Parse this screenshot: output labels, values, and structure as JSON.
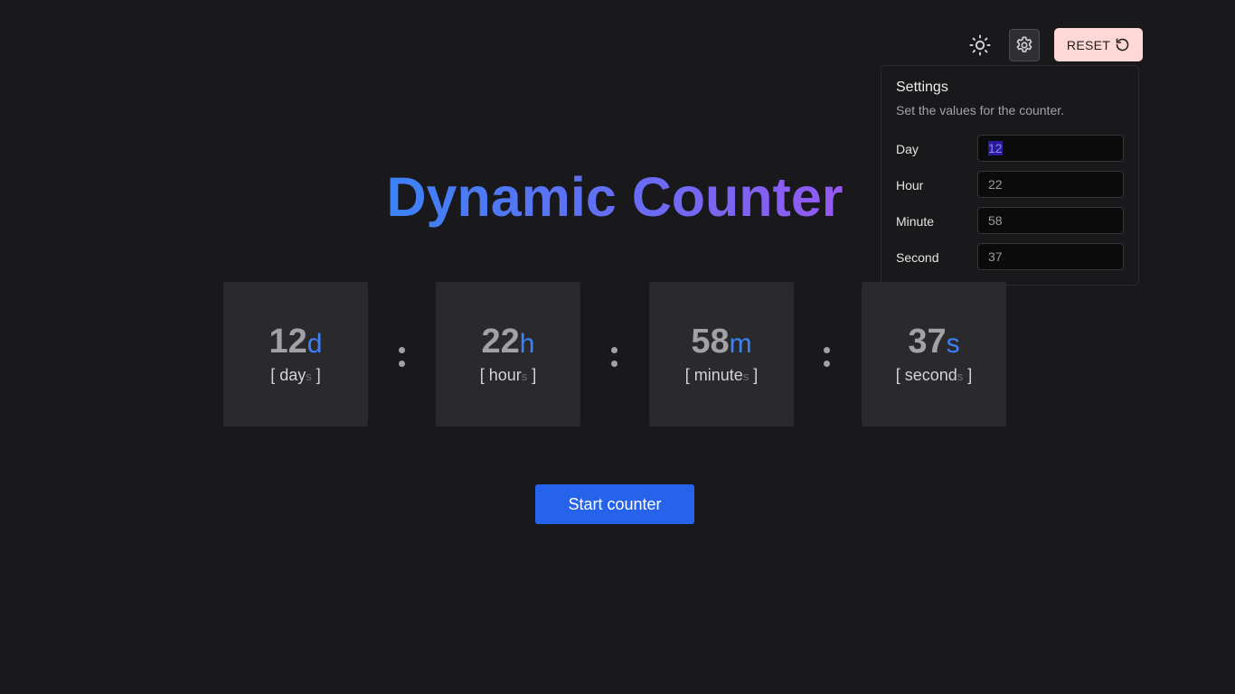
{
  "header": {
    "theme_icon": "sun-icon",
    "settings_icon": "gear-icon",
    "reset_label": "RESET",
    "reset_icon": "rotate-ccw-icon"
  },
  "settings": {
    "title": "Settings",
    "subtitle": "Set the values for the counter.",
    "fields": [
      {
        "label": "Day",
        "value": "12"
      },
      {
        "label": "Hour",
        "value": "22"
      },
      {
        "label": "Minute",
        "value": "58"
      },
      {
        "label": "Second",
        "value": "37"
      }
    ]
  },
  "title": "Dynamic Counter",
  "counter": [
    {
      "value": "12",
      "unit": "d",
      "word": "day",
      "plural": "s"
    },
    {
      "value": "22",
      "unit": "h",
      "word": "hour",
      "plural": "s"
    },
    {
      "value": "58",
      "unit": "m",
      "word": "minute",
      "plural": "s"
    },
    {
      "value": "37",
      "unit": "s",
      "word": "second",
      "plural": "s"
    }
  ],
  "bracket_open": "[",
  "bracket_close": "]",
  "start_label": "Start counter",
  "colors": {
    "background": "#19191b",
    "accent": "#3b82f6",
    "button": "#2563eb",
    "reset_bg": "#fed7d7"
  }
}
